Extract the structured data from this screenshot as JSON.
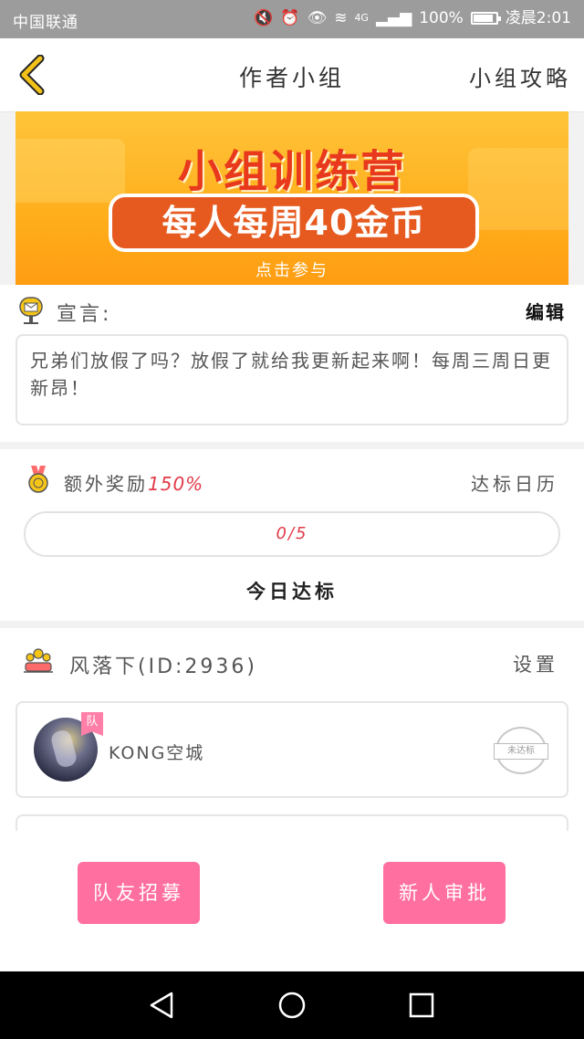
{
  "status_bar": {
    "carrier": "中国联通",
    "network": "4G",
    "battery": "100%",
    "time": "凌晨2:01"
  },
  "header": {
    "title": "作者小组",
    "guide_link": "小组攻略"
  },
  "banner": {
    "title": "小组训练营",
    "subtitle": "每人每周40金币",
    "cta": "点击参与"
  },
  "declaration": {
    "label": "宣言:",
    "edit": "编辑",
    "text": "兄弟们放假了吗？放假了就给我更新起来啊！每周三周日更新昂！"
  },
  "reward": {
    "label": "额外奖励",
    "percent": "150%",
    "calendar_link": "达标日历",
    "progress_text": "0/5",
    "progress_fraction": 0,
    "today_label": "今日达标"
  },
  "team": {
    "name": "风落下(ID:2936)",
    "settings": "设置",
    "members": [
      {
        "name": "KONG空城",
        "badge": "队",
        "status": "未达标"
      }
    ]
  },
  "actions": {
    "recruit": "队友招募",
    "approve": "新人审批"
  },
  "colors": {
    "accent_pink": "#ff6fa0",
    "highlight_red": "#e23a48",
    "banner_orange": "#ffae1c"
  }
}
